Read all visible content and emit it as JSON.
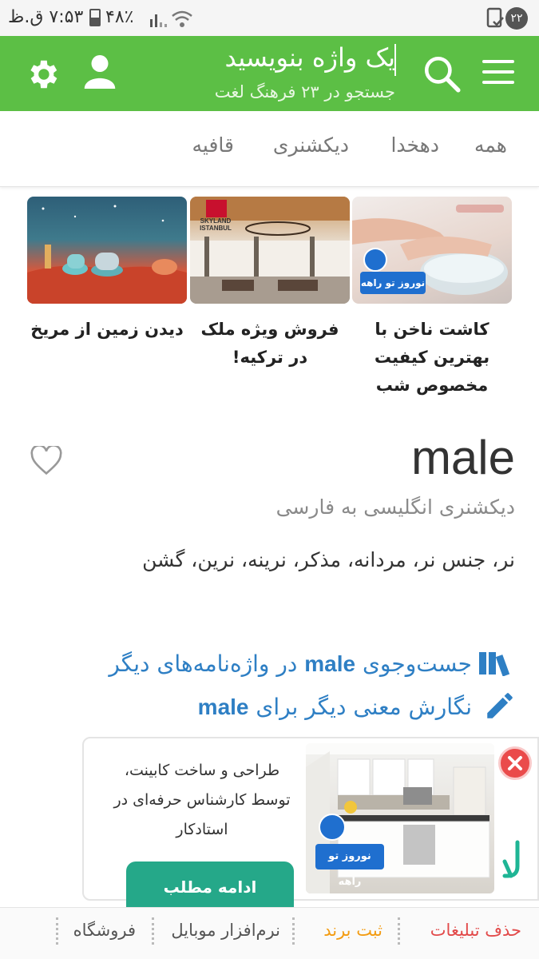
{
  "status_bar": {
    "time": "۷:۵۳ ق.ظ",
    "battery": "۴۸٪",
    "notification_count": "۲۲"
  },
  "header": {
    "search_placeholder": "یک واژه بنویسید",
    "search_hint": "جستجو در ۲۳ فرهنگ لغت",
    "icons": [
      "menu-icon",
      "search-icon",
      "user-icon",
      "gear-icon"
    ],
    "color": "#5cbf45"
  },
  "tabs": [
    {
      "label": "همه"
    },
    {
      "label": "دهخدا"
    },
    {
      "label": "دیکشنری"
    },
    {
      "label": "قافیه"
    }
  ],
  "ads": [
    {
      "caption_lines": [
        "کاشت ناخن با",
        "بهترین کیفیت",
        "مخصوص شب"
      ],
      "badge": "نوروز تو راهه"
    },
    {
      "caption_lines": [
        "فروش ویژه ملک",
        "در ترکیه!"
      ],
      "brand": "SKYLAND ISTANBUL"
    },
    {
      "caption_lines": [
        "دیدن زمین از مریخ"
      ]
    }
  ],
  "entry": {
    "word": "male",
    "dictionary": "دیکشنری انگلیسی به فارسی",
    "meaning": "نر، جنس نر، مردانه، مذکر، نرینه، نرین، گشن"
  },
  "links": {
    "search_other_prefix": "جست‌وجوی",
    "search_other_word": "male",
    "search_other_suffix": "در واژه‌نامه‌های دیگر",
    "write_meaning_prefix": "نگارش معنی دیگر برای",
    "write_meaning_word": "male"
  },
  "native_ad": {
    "text_lines": [
      "طراحی و ساخت کابینت،",
      "توسط کارشناس حرفه‌ای در",
      "استادکار"
    ],
    "badge": "نوروز تو راهه",
    "cta": "ادامه مطلب"
  },
  "bottom_bar": {
    "items": [
      {
        "label": "حذف تبلیغات",
        "color": "#e24a4a"
      },
      {
        "label": "ثبت برند",
        "color": "#f39c12"
      },
      {
        "label": "نرم‌افزار موبایل",
        "color": "#555555"
      },
      {
        "label": "فروشگاه",
        "color": "#555555"
      }
    ]
  }
}
